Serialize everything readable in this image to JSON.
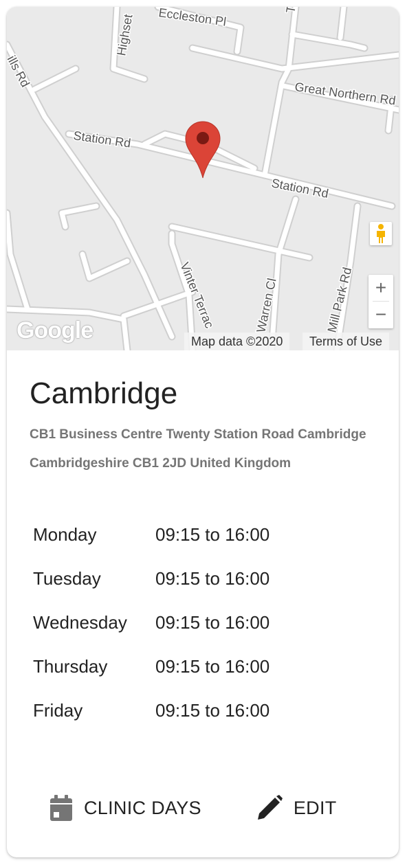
{
  "map": {
    "road_labels": {
      "eccleston": "Eccleston Pl",
      "highsett": "Highset",
      "hills_rd": "ills Rd",
      "great_northern": "Great Northern Rd",
      "station_left": "Station Rd",
      "station_right": "Station Rd",
      "vinter": "Vinter Terrac",
      "warren": "Warren Cl",
      "mill_park": "Mill Park Rd",
      "top_t": "T"
    },
    "logo": "Google",
    "attribution": "Map data ©2020",
    "terms": "Terms of Use",
    "zoom_in": "+",
    "zoom_out": "−",
    "marker_color": "#db4437"
  },
  "location": {
    "name": "Cambridge",
    "address": "CB1 Business Centre Twenty Station Road Cambridge Cambridgeshire CB1 2JD United Kingdom"
  },
  "hours": [
    {
      "day": "Monday",
      "time": "09:15 to 16:00"
    },
    {
      "day": "Tuesday",
      "time": "09:15 to 16:00"
    },
    {
      "day": "Wednesday",
      "time": "09:15 to 16:00"
    },
    {
      "day": "Thursday",
      "time": "09:15 to 16:00"
    },
    {
      "day": "Friday",
      "time": "09:15 to 16:00"
    }
  ],
  "actions": {
    "clinic_days": {
      "label": "CLINIC DAYS",
      "icon": "calendar-icon"
    },
    "edit": {
      "label": "EDIT",
      "icon": "pencil-icon"
    }
  }
}
